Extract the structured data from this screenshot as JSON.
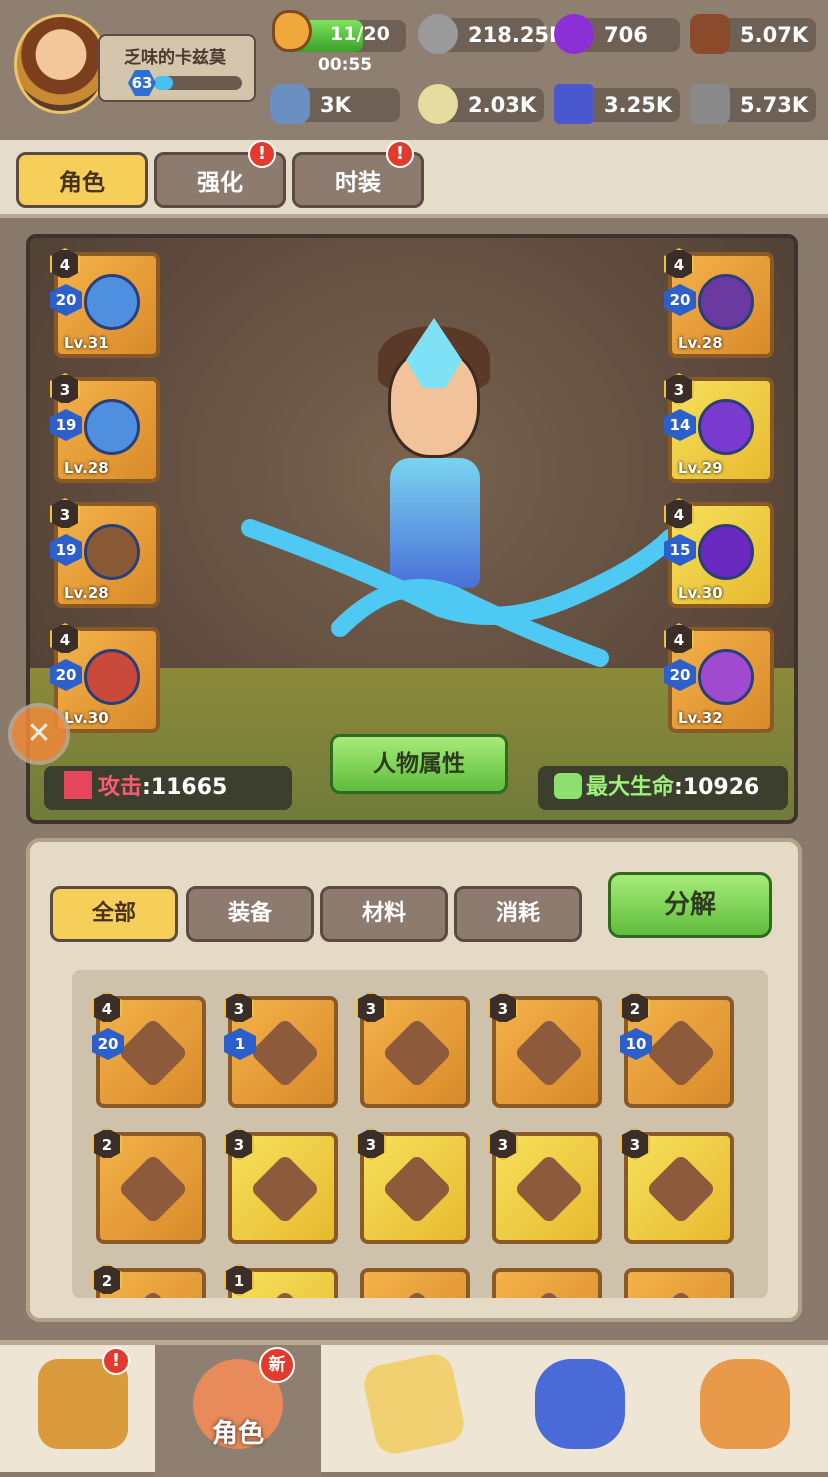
{
  "player": {
    "name": "乏味的卡兹莫",
    "level": "63",
    "xp_fraction": 0.22
  },
  "energy": {
    "value": "11/20",
    "timer": "00:55",
    "fraction": 0.55
  },
  "resources": [
    {
      "icon": "silver-nut-icon",
      "value": "218.25K"
    },
    {
      "icon": "purple-pearl-icon",
      "value": "706"
    },
    {
      "icon": "wood-logs-icon",
      "value": "5.07K"
    },
    {
      "icon": "bone-icon",
      "value": "3K"
    },
    {
      "icon": "stone-coin-icon",
      "value": "2.03K"
    },
    {
      "icon": "blue-gem-icon",
      "value": "3.25K"
    },
    {
      "icon": "ore-icon",
      "value": "5.73K"
    }
  ],
  "tabs": [
    {
      "label": "角色",
      "active": true
    },
    {
      "label": "强化",
      "alert": "!"
    },
    {
      "label": "时装",
      "alert": "!"
    }
  ],
  "equipment_left": [
    {
      "stars": "4",
      "plus": "20",
      "level": "Lv.31"
    },
    {
      "stars": "3",
      "plus": "19",
      "level": "Lv.28"
    },
    {
      "stars": "3",
      "plus": "19",
      "level": "Lv.28"
    },
    {
      "stars": "4",
      "plus": "20",
      "level": "Lv.30"
    }
  ],
  "equipment_right": [
    {
      "stars": "4",
      "plus": "20",
      "level": "Lv.28"
    },
    {
      "stars": "3",
      "plus": "14",
      "level": "Lv.29"
    },
    {
      "stars": "4",
      "plus": "15",
      "level": "Lv.30"
    },
    {
      "stars": "4",
      "plus": "20",
      "level": "Lv.32"
    }
  ],
  "stats": {
    "attack_label": "攻击",
    "attack_value": ":11665",
    "hp_label": "最大生命",
    "hp_value": ":10926"
  },
  "attr_button": "人物属性",
  "bag": {
    "tabs": [
      "全部",
      "装备",
      "材料",
      "消耗"
    ],
    "decompose": "分解",
    "items": [
      {
        "stars": "4",
        "plus": "20"
      },
      {
        "stars": "3",
        "plus": "1"
      },
      {
        "stars": "3"
      },
      {
        "stars": "3"
      },
      {
        "stars": "2",
        "plus": "10"
      },
      {
        "stars": "2"
      },
      {
        "stars": "3"
      },
      {
        "stars": "3"
      },
      {
        "stars": "3"
      },
      {
        "stars": "3"
      },
      {
        "stars": "2"
      },
      {
        "stars": "1"
      },
      {},
      {},
      {}
    ]
  },
  "nav": [
    {
      "icon": "castle-icon",
      "label": "",
      "alert": "!"
    },
    {
      "icon": "character-icon",
      "label": "角色",
      "badge": "新"
    },
    {
      "icon": "map-icon",
      "label": ""
    },
    {
      "icon": "pet-wolf-icon",
      "label": ""
    },
    {
      "icon": "treasure-bag-icon",
      "label": ""
    }
  ]
}
